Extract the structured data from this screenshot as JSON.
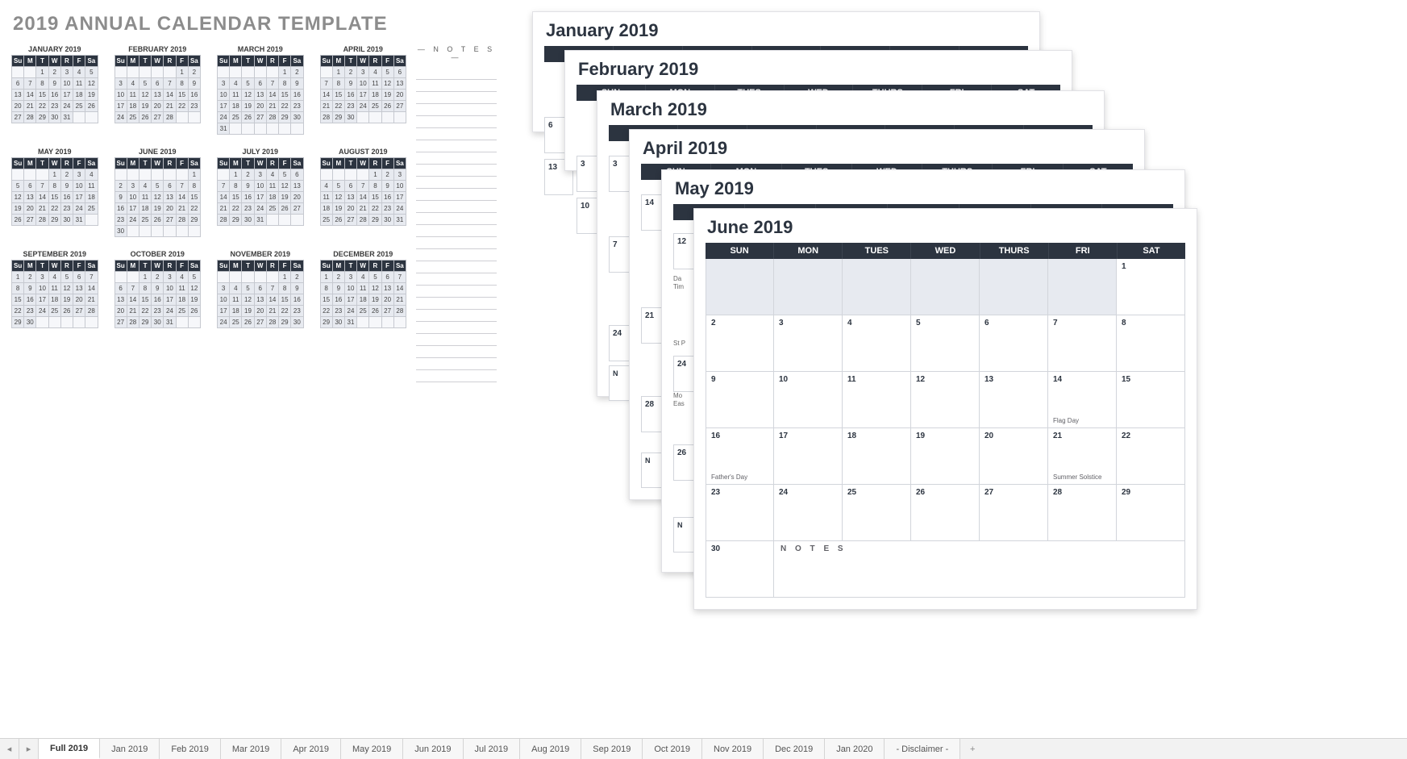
{
  "title": "2019 ANNUAL CALENDAR TEMPLATE",
  "notes_heading": "— N O T E S —",
  "day_short": [
    "Su",
    "M",
    "T",
    "W",
    "R",
    "F",
    "Sa"
  ],
  "day_long": [
    "SUN",
    "MON",
    "TUES",
    "WED",
    "THURS",
    "FRI",
    "SAT"
  ],
  "mini_months": [
    {
      "name": "JANUARY 2019",
      "start": 2,
      "days": 31
    },
    {
      "name": "FEBRUARY 2019",
      "start": 5,
      "days": 28
    },
    {
      "name": "MARCH 2019",
      "start": 5,
      "days": 31
    },
    {
      "name": "APRIL 2019",
      "start": 1,
      "days": 30
    },
    {
      "name": "MAY 2019",
      "start": 3,
      "days": 31
    },
    {
      "name": "JUNE 2019",
      "start": 6,
      "days": 30
    },
    {
      "name": "JULY 2019",
      "start": 1,
      "days": 31
    },
    {
      "name": "AUGUST 2019",
      "start": 4,
      "days": 31
    },
    {
      "name": "SEPTEMBER 2019",
      "start": 0,
      "days": 30
    },
    {
      "name": "OCTOBER 2019",
      "start": 2,
      "days": 31
    },
    {
      "name": "NOVEMBER 2019",
      "start": 5,
      "days": 30
    },
    {
      "name": "DECEMBER 2019",
      "start": 0,
      "days": 31
    }
  ],
  "cascade": [
    {
      "title": "January 2019"
    },
    {
      "title": "February 2019"
    },
    {
      "title": "March 2019"
    },
    {
      "title": "April 2019"
    },
    {
      "title": "May 2019"
    }
  ],
  "peek": {
    "jan": [
      "6",
      "13"
    ],
    "feb": [
      "3",
      "10"
    ],
    "mar": [
      "3",
      "7",
      "24",
      "N"
    ],
    "apr": [
      "14",
      "21",
      "28",
      "N"
    ],
    "may": [
      "12",
      "24",
      "26",
      "N"
    ]
  },
  "may_labels": [
    "Da",
    "Tim",
    "St P",
    "Mo",
    "Eas"
  ],
  "june": {
    "title": "June 2019",
    "start": 6,
    "days": 30,
    "events": {
      "14": "Flag Day",
      "16": "Father's Day",
      "21": "Summer Solstice"
    },
    "notes_label": "N O T E S"
  },
  "tabs": [
    "Full 2019",
    "Jan 2019",
    "Feb 2019",
    "Mar 2019",
    "Apr 2019",
    "May 2019",
    "Jun 2019",
    "Jul 2019",
    "Aug 2019",
    "Sep 2019",
    "Oct 2019",
    "Nov 2019",
    "Dec 2019",
    "Jan 2020",
    "- Disclaimer -"
  ],
  "active_tab": 0,
  "add_tab": "+"
}
